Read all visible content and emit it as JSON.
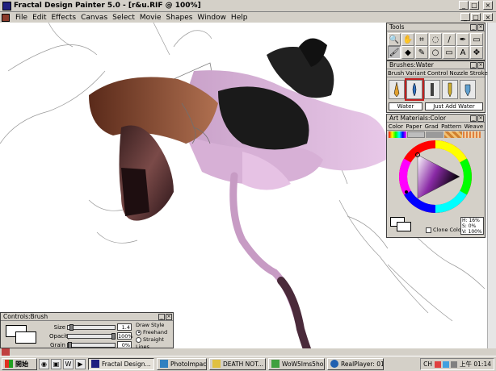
{
  "window": {
    "title": "Fractal Design Painter 5.0 - [r&u.RIF @ 100%]",
    "min_label": "_",
    "max_label": "□",
    "close_label": "×",
    "doc_min_label": "_",
    "doc_max_label": "□",
    "doc_close_label": "×"
  },
  "menu": [
    "File",
    "Edit",
    "Effects",
    "Canvas",
    "Select",
    "Movie",
    "Shapes",
    "Window",
    "Help"
  ],
  "tools_palette": {
    "title": "Tools",
    "icons": [
      "zoom-icon",
      "grabber-icon",
      "crop-icon",
      "lasso-icon",
      "magic-wand-icon",
      "dropper-icon",
      "rectangle-shape-icon",
      "brush-icon",
      "paint-bucket-icon",
      "pen-icon",
      "oval-icon",
      "rectangle-icon",
      "text-icon",
      "move-icon"
    ],
    "glyphs": [
      "🔍",
      "✋",
      "⌗",
      "◌",
      "∕",
      "✒",
      "▭",
      "🖌",
      "◆",
      "✎",
      "○",
      "▭",
      "A",
      "✥"
    ]
  },
  "brushes_palette": {
    "title": "Brushes:Water",
    "tabs": [
      "Brush",
      "Variant",
      "Control",
      "Nozzle",
      "Stroke"
    ],
    "brush_field": "Water",
    "variant_field": "Just Add Water"
  },
  "art_materials_palette": {
    "title": "Art Materials:Color",
    "tabs": [
      "Color",
      "Paper",
      "Grad",
      "Pattern",
      "Weave"
    ],
    "hsv": {
      "h": "H: 16%",
      "s": "S: 0%",
      "v": "V: 100%"
    },
    "clone_color_label": "Clone Color",
    "hue_ring_colors": [
      "#ff0000",
      "#ffff00",
      "#00ff00",
      "#00ffff",
      "#0000ff",
      "#ff00ff",
      "#ff0000"
    ],
    "triangle_color": "#8a2aa6"
  },
  "controls_brush": {
    "title": "Controls:Brush",
    "size_label": "Size",
    "size_value": "1.4",
    "opacity_label": "Opacity",
    "opacity_value": "100%",
    "grain_label": "Grain",
    "grain_value": "0%",
    "draw_style_label": "Draw Style",
    "freehand_label": "Freehand",
    "straight_lines_label": "Straight Lines"
  },
  "taskbar": {
    "start_label": "開始",
    "tasks": [
      {
        "label": "Fractal Design...",
        "active": true
      },
      {
        "label": "PhotoImpact",
        "active": false
      },
      {
        "label": "DEATH NOT...",
        "active": false
      },
      {
        "label": "WoW5Ims5ho...",
        "active": false
      },
      {
        "label": "RealPlayer: 01...",
        "active": false
      }
    ],
    "lang": "CH",
    "clock": "上午 01:14"
  }
}
